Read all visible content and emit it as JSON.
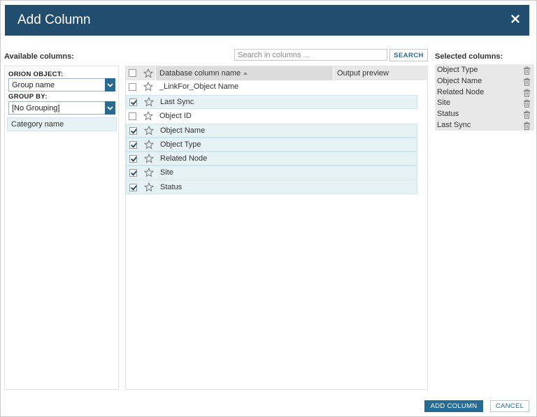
{
  "dialog": {
    "title": "Add Column",
    "colors": {
      "titlebar": "#214e6e",
      "accent": "#2b6a8f",
      "row_selected": "#e6f2f6"
    }
  },
  "available": {
    "label": "Available columns:"
  },
  "search": {
    "placeholder": "Search in columns ...",
    "button": "SEARCH"
  },
  "left": {
    "orion_label": "ORION OBJECT:",
    "orion_value": "Group name",
    "group_label": "GROUP BY:",
    "group_value": "[No Grouping]",
    "category": "Category name"
  },
  "grid": {
    "headers": {
      "name": "Database column name",
      "preview": "Output preview"
    },
    "rows": [
      {
        "name": "_LinkFor_Object Name",
        "checked": false
      },
      {
        "name": "Last Sync",
        "checked": true
      },
      {
        "name": "Object ID",
        "checked": false
      },
      {
        "name": "Object Name",
        "checked": true
      },
      {
        "name": "Object Type",
        "checked": true
      },
      {
        "name": "Related Node",
        "checked": true
      },
      {
        "name": "Site",
        "checked": true
      },
      {
        "name": "Status",
        "checked": true
      }
    ]
  },
  "selected": {
    "label": "Selected columns:",
    "items": [
      "Object Type",
      "Object Name",
      "Related Node",
      "Site",
      "Status",
      "Last Sync"
    ]
  },
  "buttons": {
    "add": "ADD COLUMN",
    "cancel": "CANCEL"
  }
}
